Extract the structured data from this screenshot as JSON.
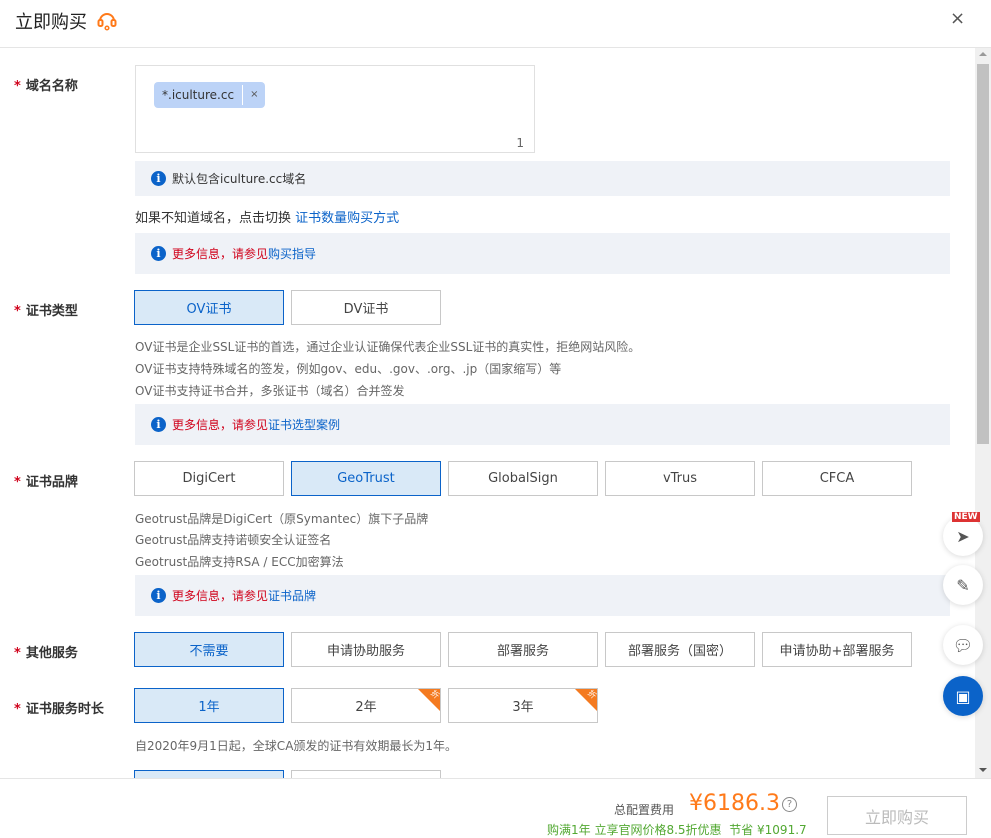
{
  "header": {
    "title": "立即购买",
    "close": "×"
  },
  "domain": {
    "label": "域名名称",
    "tag": "*.iculture.cc",
    "tag_remove": "×",
    "count": "1",
    "info": "默认包含iculture.cc域名",
    "switch_text": "如果不知道域名，点击切换 ",
    "switch_link": "证书数量购买方式",
    "more_red": "更多信息，请参见",
    "more_link": "购买指导"
  },
  "cert_type": {
    "label": "证书类型",
    "options": [
      "OV证书",
      "DV证书"
    ],
    "selected": "OV证书",
    "desc": [
      "OV证书是企业SSL证书的首选，通过企业认证确保代表企业SSL证书的真实性，拒绝网站风险。",
      "OV证书支持特殊域名的签发，例如gov、edu、.gov、.org、.jp（国家缩写）等",
      "OV证书支持证书合并，多张证书（域名）合并签发"
    ],
    "more_red": "更多信息，请参见",
    "more_link": "证书选型案例"
  },
  "brand": {
    "label": "证书品牌",
    "options": [
      "DigiCert",
      "GeoTrust",
      "GlobalSign",
      "vTrus",
      "CFCA"
    ],
    "selected": "GeoTrust",
    "desc": [
      "Geotrust品牌是DigiCert（原Symantec）旗下子品牌",
      "Geotrust品牌支持诺顿安全认证签名",
      "Geotrust品牌支持RSA / ECC加密算法"
    ],
    "more_red": "更多信息，请参见",
    "more_link": "证书品牌"
  },
  "service": {
    "label": "其他服务",
    "options": [
      "不需要",
      "申请协助服务",
      "部署服务",
      "部署服务（国密）",
      "申请协助+部署服务"
    ],
    "selected": "不需要"
  },
  "duration": {
    "label": "证书服务时长",
    "options": [
      "1年",
      "2年",
      "3年"
    ],
    "selected": "1年",
    "discount_badge": "折",
    "note": "自2020年9月1日起，全球CA颁发的证书有效期最长为1年。"
  },
  "float": {
    "new_badge": "NEW"
  },
  "footer": {
    "total_label": "总配置费用",
    "price": "¥6186.3",
    "promo": "购满1年 立享官网价格8.5折优惠",
    "save_label": "节省",
    "save_value": "¥1091.7",
    "buy": "立即购买"
  },
  "colors": {
    "accent": "#0b63c9",
    "price": "#ff7a1a",
    "promo": "#52a832",
    "required": "#d0021b"
  }
}
